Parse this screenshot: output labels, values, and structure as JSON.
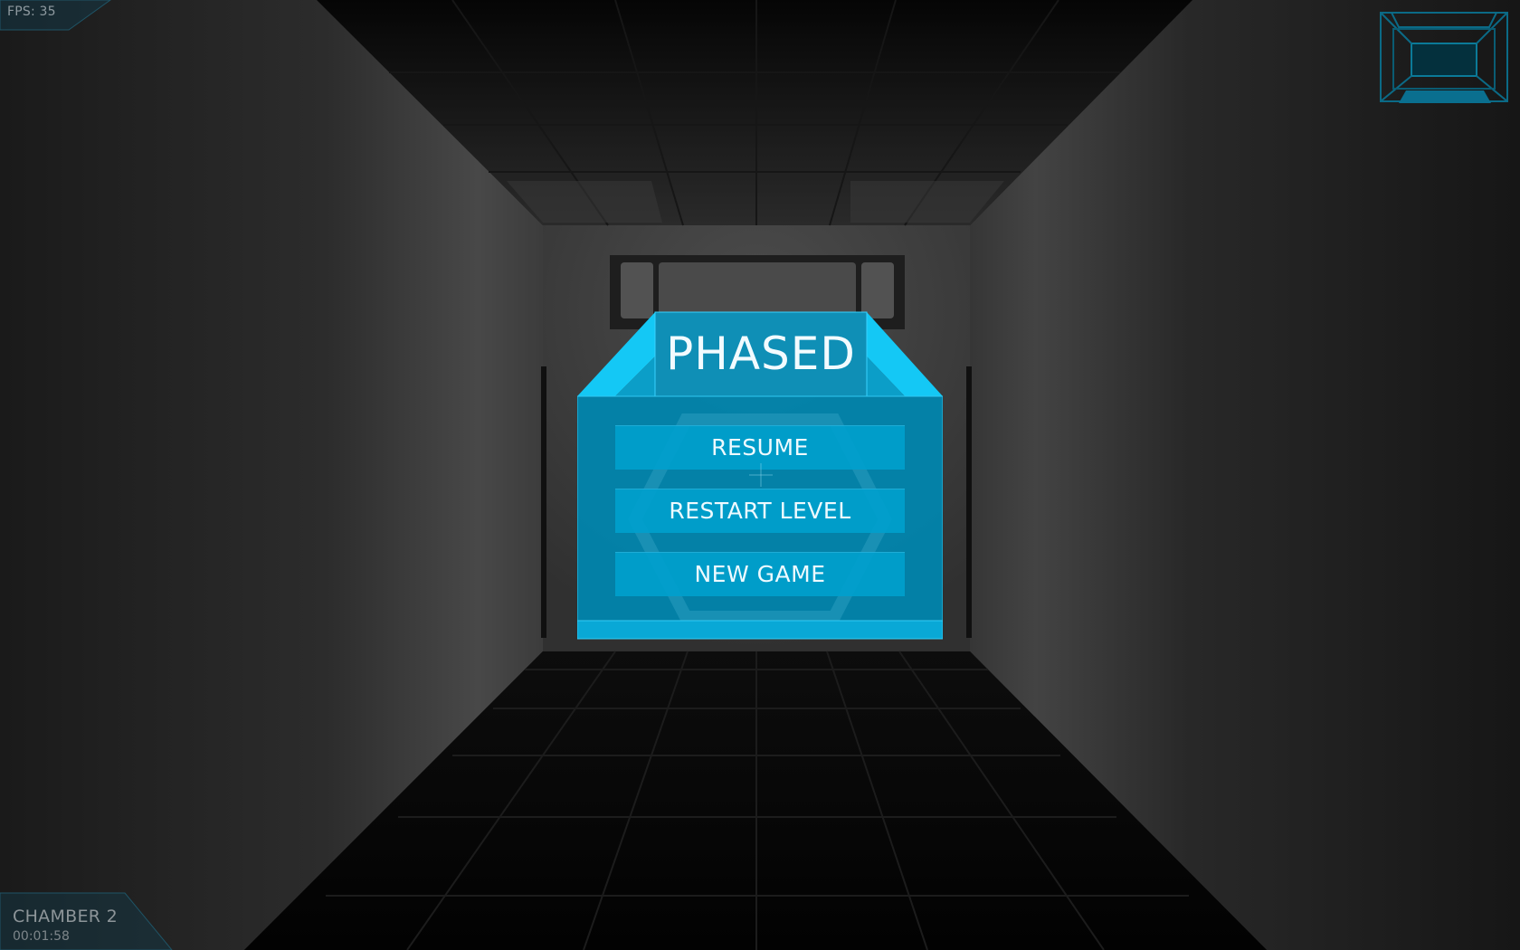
{
  "hud": {
    "fps_label": "FPS: 35",
    "chamber_name": "CHAMBER 2",
    "timer": "00:01:58",
    "box_icon": "box-outline-icon"
  },
  "menu": {
    "title": "PHASED",
    "buttons": [
      {
        "label": "RESUME"
      },
      {
        "label": "RESTART LEVEL"
      },
      {
        "label": "NEW GAME"
      }
    ]
  },
  "colors": {
    "accent": "#00b4e6",
    "accent_dark": "#0a6f8f",
    "hud_text": "#8f9aa0",
    "background": "#000000"
  }
}
